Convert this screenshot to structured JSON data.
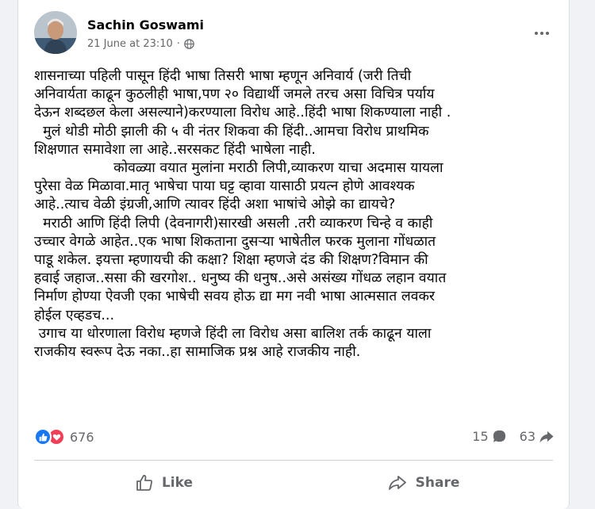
{
  "post": {
    "author": "Sachin Goswami",
    "timestamp": "21 June at 23:10",
    "separator": "·",
    "visibility_icon": "globe-icon",
    "more_icon": "more-options-icon",
    "body": "शासनाच्या पहिली पासून हिंदी भाषा तिसरी भाषा म्हणून अनिवार्य (जरी तिची\nअनिवार्यता काढून कुठलीही भाषा,पण २० विद्यार्थी जमले तरच असा विचित्र पर्याय\nदेऊन शब्दछल केला असल्याने)करण्याला विरोध आहे..हिंदी भाषा शिकण्याला नाही .\n  मुलं थोडी मोठी झाली की ५ वी नंतर शिकवा की हिंदी..आमचा विरोध प्राथमिक\nशिक्षणात समावेशा ला आहे..सरसकट हिंदी भाषेला नाही.\n                  कोवळ्या वयात मुलांना मराठी लिपी,व्याकरण याचा अदमास यायला\nपुरेसा वेळ मिळावा.मातृ भाषेचा पाया घट्ट व्हावा यासाठी प्रयत्न होणे आवश्यक\nआहे..त्याच वेळी इंग्रजी,आणि त्यावर हिंदी अशा भाषांचे ओझे का द्यायचे?\n  मराठी आणि हिंदी लिपी (देवनागरी)सारखी असली .तरी व्याकरण चिन्हे व काही\nउच्चार वेगळे आहेत..एक भाषा शिकताना दुसऱ्या भाषेतील फरक मुलाना गोंधळात\nपाडू शकेल. इयत्ता म्हणायची की कक्षा? शिक्षा म्हणजे दंड की शिक्षण?विमान की\nहवाई जहाज..ससा की खरगोश.. धनुष्य की धनुष..असे असंख्य गोंधळ लहान वयात\nनिर्माण होण्या ऐवजी एका भाषेची सवय होऊ द्या मग नवी भाषा आत्मसात लवकर\nहोईल एव्हडच...\n उगाच या धोरणाला विरोध म्हणजे हिंदी ला विरोध असा बालिश तर्क काढून याला\nराजकीय स्वरूप देऊ नका..हा सामाजिक प्रश्न आहे राजकीय नाही."
  },
  "engagement": {
    "reaction_icons": [
      "like-icon",
      "love-icon"
    ],
    "reaction_count": "676",
    "comment_count": "15",
    "comment_icon": "comment-icon",
    "share_count": "63",
    "share_icon": "share-arrow-icon"
  },
  "actions": {
    "like_label": "Like",
    "like_icon": "thumbs-up-icon",
    "share_label": "Share",
    "share_icon": "share-icon"
  },
  "colors": {
    "like_blue": "#1877f2",
    "love_red": "#f33e58",
    "secondary_text": "#65676b"
  }
}
